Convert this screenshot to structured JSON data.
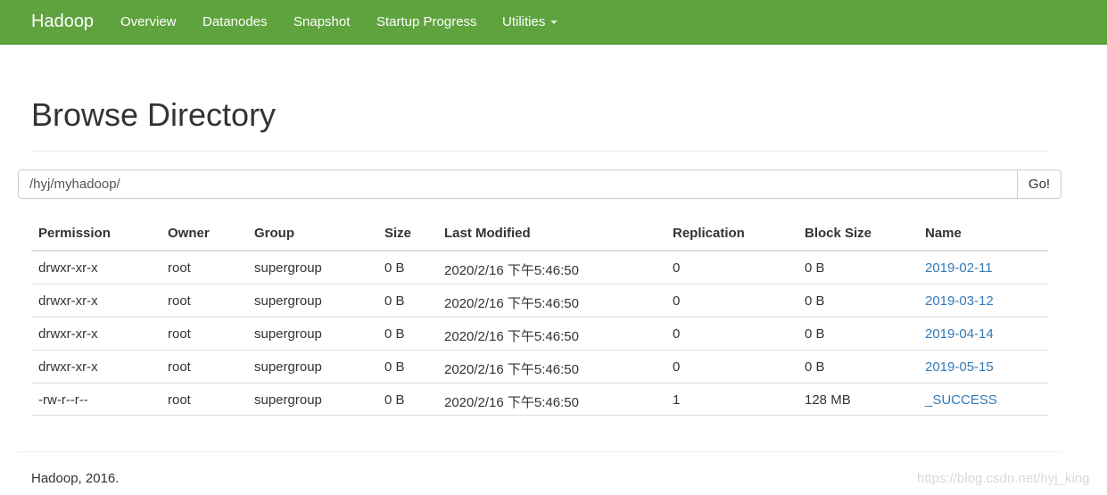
{
  "navbar": {
    "brand": "Hadoop",
    "links": [
      "Overview",
      "Datanodes",
      "Snapshot",
      "Startup Progress",
      "Utilities"
    ],
    "color": "#5fa33e"
  },
  "page": {
    "title": "Browse Directory"
  },
  "path_bar": {
    "value": "/hyj/myhadoop/",
    "go_label": "Go!"
  },
  "table": {
    "headers": [
      "Permission",
      "Owner",
      "Group",
      "Size",
      "Last Modified",
      "Replication",
      "Block Size",
      "Name"
    ],
    "rows": [
      [
        "drwxr-xr-x",
        "root",
        "supergroup",
        "0 B",
        "2020/2/16 下午5:46:50",
        "0",
        "0 B",
        "2019-02-11"
      ],
      [
        "drwxr-xr-x",
        "root",
        "supergroup",
        "0 B",
        "2020/2/16 下午5:46:50",
        "0",
        "0 B",
        "2019-03-12"
      ],
      [
        "drwxr-xr-x",
        "root",
        "supergroup",
        "0 B",
        "2020/2/16 下午5:46:50",
        "0",
        "0 B",
        "2019-04-14"
      ],
      [
        "drwxr-xr-x",
        "root",
        "supergroup",
        "0 B",
        "2020/2/16 下午5:46:50",
        "0",
        "0 B",
        "2019-05-15"
      ],
      [
        "-rw-r--r--",
        "root",
        "supergroup",
        "0 B",
        "2020/2/16 下午5:46:50",
        "1",
        "128 MB",
        "_SUCCESS"
      ]
    ],
    "link_color": "#337ab7"
  },
  "footer": {
    "text": "Hadoop, 2016.",
    "watermark": "https://blog.csdn.net/hyj_king"
  }
}
